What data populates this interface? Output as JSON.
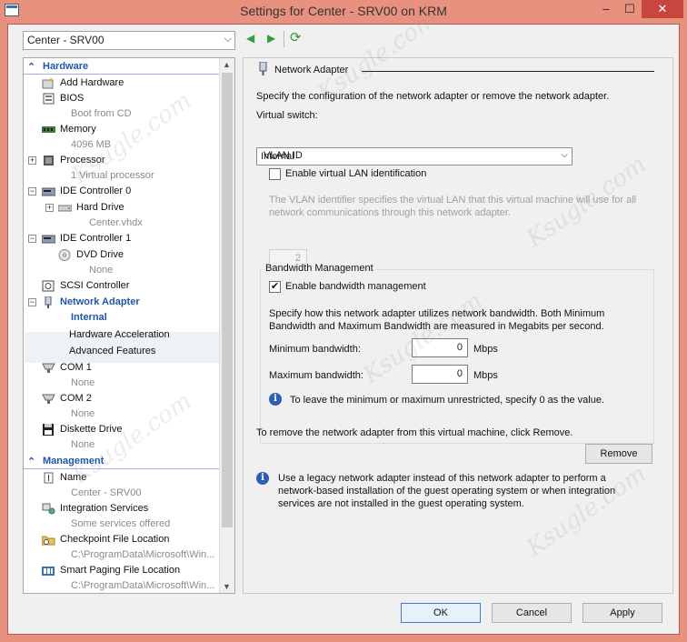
{
  "window": {
    "title": "Settings for Center - SRV00 on KRM",
    "controls": {
      "minimize": "–",
      "maximize": "☐",
      "close": "✕"
    }
  },
  "toolbar": {
    "vm_selector": "Center - SRV00",
    "prev": "◀",
    "next": "▶",
    "refresh": "⟳"
  },
  "tree": {
    "hardware_header": "Hardware",
    "management_header": "Management",
    "items": {
      "add_hardware": "Add Hardware",
      "bios": "BIOS",
      "bios_sub": "Boot from CD",
      "memory": "Memory",
      "memory_sub": "4096 MB",
      "processor": "Processor",
      "processor_sub": "1 Virtual processor",
      "ide0": "IDE Controller 0",
      "hard_drive": "Hard Drive",
      "hard_drive_sub": "Center.vhdx",
      "ide1": "IDE Controller 1",
      "dvd_drive": "DVD Drive",
      "dvd_drive_sub": "None",
      "scsi": "SCSI Controller",
      "network_adapter": "Network Adapter",
      "network_adapter_sub": "Internal",
      "hw_accel": "Hardware Acceleration",
      "adv_features": "Advanced Features",
      "com1": "COM 1",
      "com1_sub": "None",
      "com2": "COM 2",
      "com2_sub": "None",
      "diskette": "Diskette Drive",
      "diskette_sub": "None",
      "name": "Name",
      "name_sub": "Center - SRV00",
      "integration": "Integration Services",
      "integration_sub": "Some services offered",
      "checkpoint": "Checkpoint File Location",
      "checkpoint_sub": "C:\\ProgramData\\Microsoft\\Win...",
      "smart_paging": "Smart Paging File Location",
      "smart_paging_sub": "C:\\ProgramData\\Microsoft\\Win..."
    }
  },
  "pane": {
    "title": "Network Adapter",
    "description": "Specify the configuration of the network adapter or remove the network adapter.",
    "virtual_switch_label": "Virtual switch:",
    "virtual_switch_value": "Internal",
    "vlan_group": "VLAN ID",
    "vlan_enable": "Enable virtual LAN identification",
    "vlan_enabled": false,
    "vlan_desc1": "The VLAN identifier specifies the virtual LAN that this virtual machine will use for all",
    "vlan_desc2": "network communications through this network adapter.",
    "vlan_value": "2",
    "bw_group": "Bandwidth Management",
    "bw_enable": "Enable bandwidth management",
    "bw_enabled": true,
    "bw_desc1": "Specify how this network adapter utilizes network bandwidth. Both Minimum",
    "bw_desc2": "Bandwidth and Maximum Bandwidth are measured in Megabits per second.",
    "min_label": "Minimum bandwidth:",
    "min_value": "0",
    "max_label": "Maximum bandwidth:",
    "max_value": "0",
    "unit": "Mbps",
    "bw_info": "To leave the minimum or maximum unrestricted, specify 0 as the value.",
    "remove_text": "To remove the network adapter from this virtual machine, click Remove.",
    "remove_button": "Remove",
    "legacy_info1": "Use a legacy network adapter instead of this network adapter to perform a",
    "legacy_info2": "network-based installation of the guest operating system or when integration",
    "legacy_info3": "services are not installed in the guest operating system."
  },
  "footer": {
    "ok": "OK",
    "cancel": "Cancel",
    "apply": "Apply"
  },
  "watermark": "Ksugle.com",
  "colors": {
    "title_bar": "#e8917f",
    "close": "#c7463d",
    "tree_header": "#1f56a8",
    "info": "#2f5fb3"
  }
}
